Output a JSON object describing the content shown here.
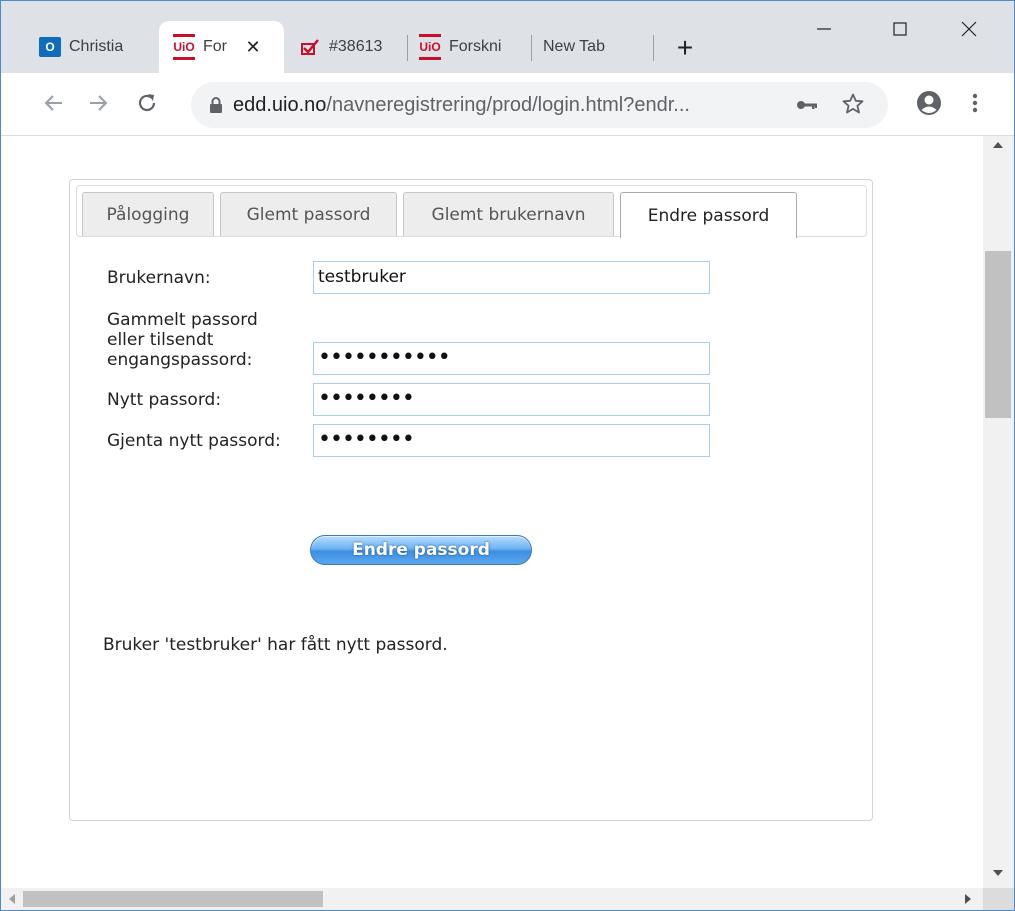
{
  "browser": {
    "tabs": [
      {
        "title": "Christia",
        "favicon": "outlook-icon"
      },
      {
        "title": "For",
        "favicon": "uio-icon"
      },
      {
        "title": "#38613",
        "favicon": "checkmark-icon"
      },
      {
        "title": "Forskni",
        "favicon": "uio-icon"
      },
      {
        "title": "New Tab",
        "favicon": ""
      }
    ],
    "favicon_text": {
      "outlook": "O",
      "uio": "UiO"
    },
    "url_domain": "edd.uio.no",
    "url_rest": "/navneregistrering/prod/login.html?endr..."
  },
  "page": {
    "tabs": [
      {
        "label": "Pålogging"
      },
      {
        "label": "Glemt passord"
      },
      {
        "label": "Glemt brukernavn"
      },
      {
        "label": "Endre passord"
      }
    ],
    "form": {
      "username_label": "Brukernavn:",
      "username_value": "testbruker",
      "old_password_label_lines": [
        "Gammelt passord",
        "eller tilsendt",
        "engangspassord:"
      ],
      "old_password_value": "•••••••••••",
      "new_password_label": "Nytt passord:",
      "new_password_value": "••••••••",
      "repeat_password_label": "Gjenta nytt passord:",
      "repeat_password_value": "••••••••",
      "submit_label": "Endre passord"
    },
    "message": "Bruker 'testbruker' har fått nytt passord."
  },
  "colors": {
    "accent": "#3e8fe0",
    "uio_red": "#c8102e",
    "input_border": "#a8cfe6"
  }
}
